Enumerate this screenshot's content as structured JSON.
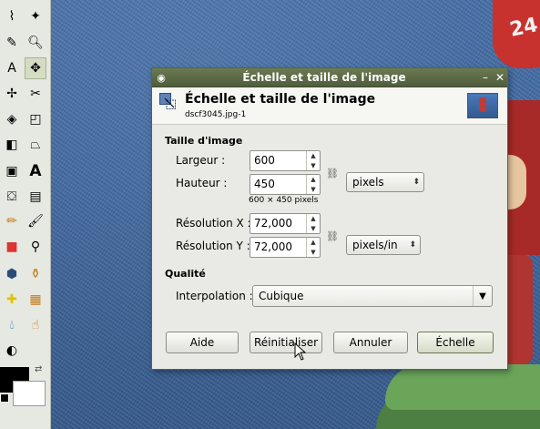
{
  "dialog": {
    "window_title": "Échelle et taille de l'image",
    "header_title": "Échelle et taille de l'image",
    "header_subtitle": "dscf3045.jpg-1",
    "image_size_section": "Taille d'image",
    "width_label": "Largeur :",
    "width_value": "600",
    "height_label": "Hauteur :",
    "height_value": "450",
    "size_unit": "pixels",
    "size_hint": "600 × 450 pixels",
    "res_x_label": "Résolution X :",
    "res_x_value": "72,000",
    "res_y_label": "Résolution Y :",
    "res_y_value": "72,000",
    "res_unit": "pixels/in",
    "quality_section": "Qualité",
    "interpolation_label": "Interpolation :",
    "interpolation_value": "Cubique",
    "buttons": {
      "help": "Aide",
      "reset": "Réinitialiser",
      "cancel": "Annuler",
      "scale": "Échelle"
    }
  },
  "canvas": {
    "figure_number": "24"
  },
  "toolbox": {
    "tools": [
      "lasso-icon",
      "fuzzy-select-icon",
      "eyedropper-icon",
      "zoom-icon",
      "text-tool-icon",
      "move-icon",
      "align-icon",
      "crop-icon",
      "rotate-icon",
      "scale-icon",
      "flip-icon",
      "perspective-icon",
      "cage-icon",
      "text-icon",
      "bucket-fill-icon",
      "blend-icon",
      "pencil-icon",
      "paintbrush-icon",
      "eraser-icon",
      "airbrush-icon",
      "ink-icon",
      "clone-icon",
      "heal-icon",
      "perspective-clone-icon",
      "blur-icon",
      "smudge-icon",
      "dodge-icon"
    ],
    "fg_color": "#000000",
    "bg_color": "#ffffff"
  }
}
